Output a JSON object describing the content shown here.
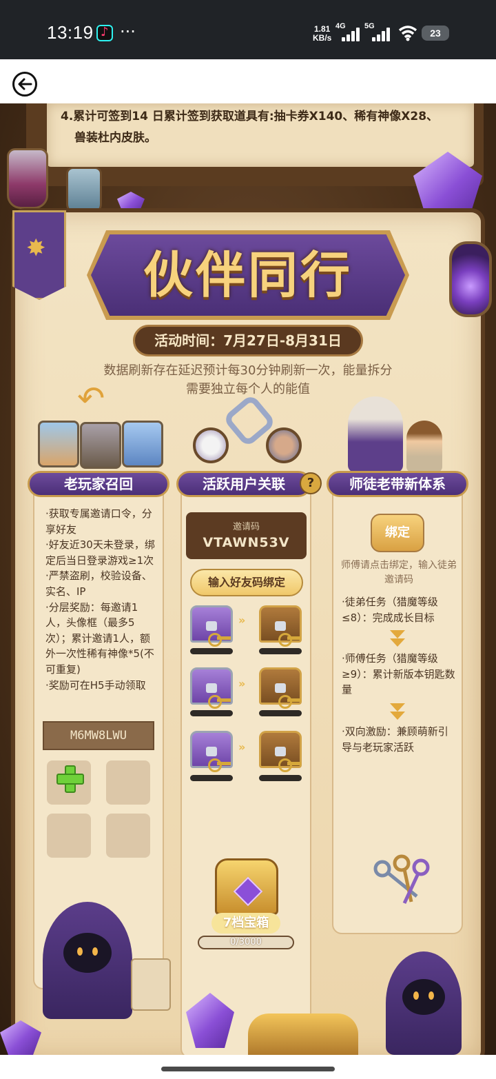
{
  "status_bar": {
    "time": "13:19",
    "dots": "···",
    "net_speed_value": "1.81",
    "net_speed_unit": "KB/s",
    "sim1_label": "4G",
    "sim2_label": "5G",
    "battery": "23"
  },
  "rules": {
    "line1": "4.累计可签到14 日累计签到获取道具有:抽卡券X140、稀有神像X28、",
    "line2": "兽装杜内皮肤。"
  },
  "title": "伙伴同行",
  "activity_time": "活动时间：7月27日-8月31日",
  "notice": "数据刷新存在延迟预计每30分钟刷新一次，能量拆分需要独立每个人的能值",
  "columns": {
    "left": {
      "header": "老玩家召回",
      "bullets": [
        "·获取专属邀请口令，分享好友",
        "·好友近30天未登录，绑定后当日登录游戏≥1次",
        "·严禁盗刷，校验设备、实名、IP",
        "·分层奖励：每邀请1人，头像框（最多5次）；累计邀请1人，额外一次性稀有神像*5(不可重复)",
        "·奖励可在H5手动领取"
      ],
      "code": "M6MW8LWU"
    },
    "middle": {
      "header": "活跃用户关联",
      "help": "?",
      "invite_label": "邀请码",
      "invite_code": "VTAWN53V",
      "bind_friend_button": "输入好友码绑定",
      "arrows": "»",
      "chest_label": "7档宝箱",
      "progress_text": "0/3000",
      "progress_fraction": 0
    },
    "right": {
      "header": "师徒老带新体系",
      "bind_button": "绑定",
      "bind_hint": "师傅请点击绑定，输入徒弟邀请码",
      "task_apprentice": "·徒弟任务（猎魔等级≤8）：完成成长目标",
      "task_master": "·师傅任务（猎魔等级≥9）：累计新版本钥匙数量",
      "incentive": "·双向激励：兼顾萌新引导与老玩家活跃"
    }
  },
  "colors": {
    "accent_purple": "#5d3f8a",
    "gold": "#c99b50",
    "parchment": "#f3e4c4"
  }
}
